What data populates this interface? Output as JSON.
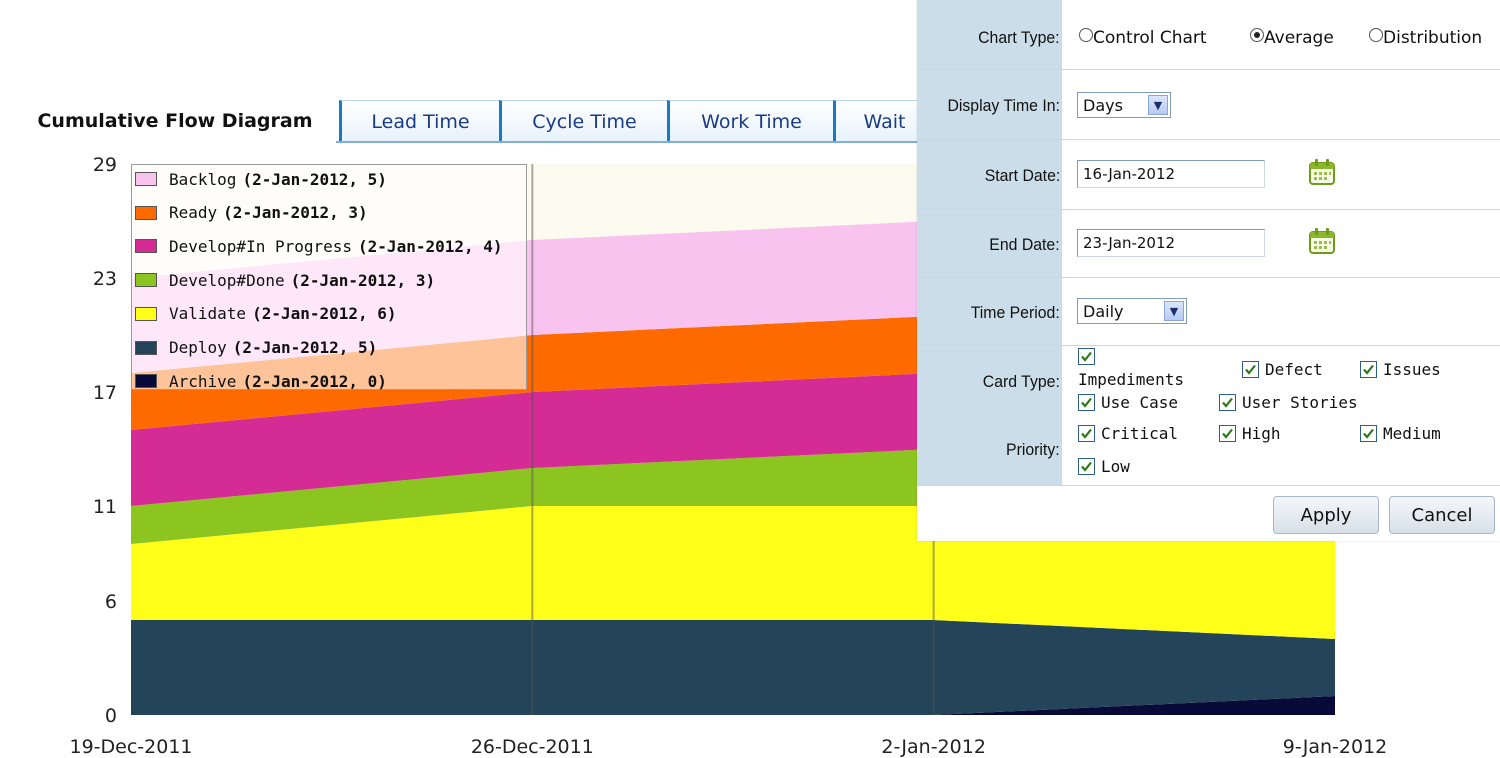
{
  "tabs": [
    {
      "label": "Cumulative Flow Diagram",
      "active": true
    },
    {
      "label": "Lead Time"
    },
    {
      "label": "Cycle Time"
    },
    {
      "label": "Work Time"
    },
    {
      "label": "Wait"
    }
  ],
  "chart_data": {
    "type": "area",
    "stacked": true,
    "x": [
      "19-Dec-2011",
      "26-Dec-2011",
      "2-Jan-2012",
      "9-Jan-2012"
    ],
    "ylim": [
      0,
      29
    ],
    "yticks": [
      0,
      6,
      11,
      17,
      23,
      29
    ],
    "series": [
      {
        "name": "Archive",
        "color": "#0a0a3a",
        "values": [
          0,
          0,
          0,
          1
        ]
      },
      {
        "name": "Deploy",
        "color": "#24445a",
        "values": [
          5,
          5,
          5,
          3
        ]
      },
      {
        "name": "Validate",
        "color": "#ffff1a",
        "values": [
          4,
          6,
          6,
          6
        ]
      },
      {
        "name": "Develop#Done",
        "color": "#8cc420",
        "values": [
          2,
          2,
          3,
          3
        ]
      },
      {
        "name": "Develop#In Progress",
        "color": "#d42b95",
        "values": [
          4,
          4,
          4,
          4
        ]
      },
      {
        "name": "Ready",
        "color": "#ff6a00",
        "values": [
          3,
          3,
          3,
          3
        ]
      },
      {
        "name": "Backlog",
        "color": "#f9c3ef",
        "values": [
          5,
          5,
          5,
          5
        ]
      }
    ],
    "legend": [
      {
        "name": "Backlog",
        "detail": "(2-Jan-2012, 5)",
        "color": "#f9c3ef"
      },
      {
        "name": "Ready",
        "detail": "(2-Jan-2012, 3)",
        "color": "#ff6a00"
      },
      {
        "name": "Develop#In Progress",
        "detail": "(2-Jan-2012, 4)",
        "color": "#d42b95"
      },
      {
        "name": "Develop#Done",
        "detail": "(2-Jan-2012, 3)",
        "color": "#8cc420"
      },
      {
        "name": "Validate",
        "detail": "(2-Jan-2012, 6)",
        "color": "#ffff1a"
      },
      {
        "name": "Deploy",
        "detail": "(2-Jan-2012, 5)",
        "color": "#24445a"
      },
      {
        "name": "Archive",
        "detail": "(2-Jan-2012, 0)",
        "color": "#0a0a3a"
      }
    ],
    "legend_placement": "top-left"
  },
  "panel": {
    "chart_type": {
      "label": "Chart Type:",
      "options": [
        "Control Chart",
        "Average",
        "Distribution"
      ],
      "selected": "Average"
    },
    "display_time": {
      "label": "Display Time In:",
      "value": "Days"
    },
    "start_date": {
      "label": "Start Date:",
      "value": "16-Jan-2012"
    },
    "end_date": {
      "label": "End Date:",
      "value": "23-Jan-2012"
    },
    "time_period": {
      "label": "Time Period:",
      "value": "Daily"
    },
    "card_type": {
      "label": "Card Type:",
      "options": [
        {
          "label": "Impediments",
          "checked": true
        },
        {
          "label": "Defect",
          "checked": true
        },
        {
          "label": "Issues",
          "checked": true
        },
        {
          "label": "Use Case",
          "checked": true
        },
        {
          "label": "User Stories",
          "checked": true
        }
      ]
    },
    "priority": {
      "label": "Priority:",
      "options": [
        {
          "label": "Critical",
          "checked": true
        },
        {
          "label": "High",
          "checked": true
        },
        {
          "label": "Medium",
          "checked": true
        },
        {
          "label": "Low",
          "checked": true
        }
      ]
    },
    "apply_label": "Apply",
    "cancel_label": "Cancel"
  }
}
